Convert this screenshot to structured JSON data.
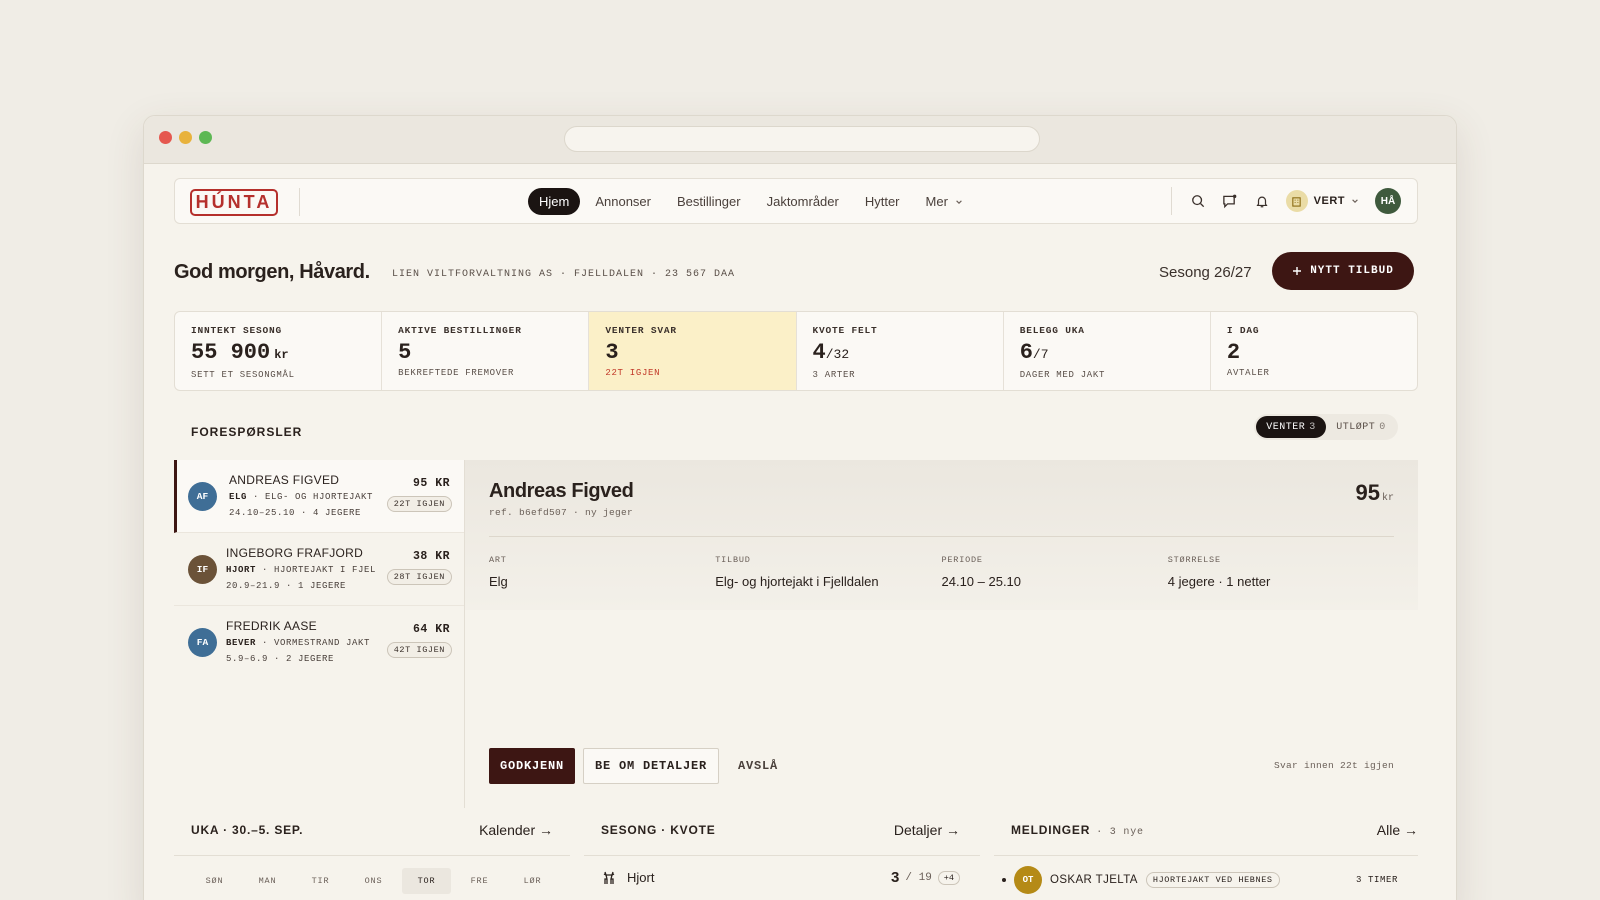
{
  "brand": {
    "logo": "HÚNTA"
  },
  "nav": {
    "links": [
      "Hjem",
      "Annonser",
      "Bestillinger",
      "Jaktområder",
      "Hytter",
      "Mer"
    ],
    "role_label": "VERT",
    "user_initials": "HÅ"
  },
  "header": {
    "greeting": "God morgen, Håvard.",
    "subtitle": "LIEN VILTFORVALTNING AS · FJELLDALEN · 23 567 DAA",
    "season": "Sesong 26/27",
    "new_offer_label": "NYTT TILBUD"
  },
  "stats": [
    {
      "label": "INNTEKT SESONG",
      "value": "55 900",
      "unit": "kr",
      "sub": "SETT ET SESONGMÅL"
    },
    {
      "label": "AKTIVE BESTILLINGER",
      "value": "5",
      "sub": "BEKREFTEDE FREMOVER"
    },
    {
      "label": "VENTER SVAR",
      "value": "3",
      "sub": "22T IGJEN"
    },
    {
      "label": "KVOTE FELT",
      "value": "4",
      "frac": "/32",
      "sub": "3 ARTER"
    },
    {
      "label": "BELEGG UKA",
      "value": "6",
      "frac": "/7",
      "sub": "DAGER MED JAKT"
    },
    {
      "label": "I DAG",
      "value": "2",
      "sub": "AVTALER"
    }
  ],
  "requests": {
    "title": "FORESPØRSLER",
    "filters": [
      {
        "label": "VENTER",
        "count": "3"
      },
      {
        "label": "UTLØPT",
        "count": "0"
      }
    ],
    "items": [
      {
        "initials": "AF",
        "color": "#3f6e96",
        "name": "ANDREAS FIGVED",
        "species": "ELG",
        "offer": "ELG- OG HJORTEJAKT",
        "dates": "24.10–25.10 · 4 JEGERE",
        "price": "95 KR",
        "badge": "22T IGJEN"
      },
      {
        "initials": "IF",
        "color": "#6b5238",
        "name": "INGEBORG FRAFJORD",
        "species": "HJORT",
        "offer": "HJORTEJAKT I FJEL",
        "dates": "20.9–21.9 · 1 JEGERE",
        "price": "38 KR",
        "badge": "28T IGJEN"
      },
      {
        "initials": "FA",
        "color": "#3f6e96",
        "name": "FREDRIK AASE",
        "species": "BEVER",
        "offer": "VORMESTRAND JAKT",
        "dates": "5.9–6.9 · 2 JEGERE",
        "price": "64 KR",
        "badge": "42T IGJEN"
      }
    ]
  },
  "detail": {
    "name": "Andreas Figved",
    "ref": "ref. b6efd507 · ny jeger",
    "price": "95",
    "price_unit": "kr",
    "fields": [
      {
        "label": "ART",
        "value": "Elg"
      },
      {
        "label": "TILBUD",
        "value": "Elg- og hjortejakt i Fjelldalen"
      },
      {
        "label": "PERIODE",
        "value": "24.10 – 25.10"
      },
      {
        "label": "STØRRELSE",
        "value": "4 jegere · 1 netter"
      }
    ],
    "approve_label": "GODKJENN",
    "ask_label": "BE OM DETALJER",
    "decline_label": "AVSLÅ",
    "deadline": "Svar innen 22t igjen"
  },
  "week": {
    "title": "UKA · 30.–5. SEP.",
    "link": "Kalender →",
    "days": [
      "SØN",
      "MAN",
      "TIR",
      "ONS",
      "TOR",
      "FRE",
      "LØR"
    ]
  },
  "quota": {
    "title": "SESONG · KVOTE",
    "link": "Detaljer →",
    "row": {
      "species": "Hjort",
      "value": "3",
      "total": "/ 19",
      "plus": "+4"
    }
  },
  "messages": {
    "title": "MELDINGER",
    "count_label": "· 3 nye",
    "link": "Alle →",
    "row": {
      "initials": "OT",
      "name": "OSKAR TJELTA",
      "tag": "HJORTEJAKT VED HEBNES",
      "time": "3 TIMER"
    }
  },
  "colors": {
    "accent": "#3d1613",
    "brand": "#b5302c",
    "highlight": "#fbf0c8"
  }
}
